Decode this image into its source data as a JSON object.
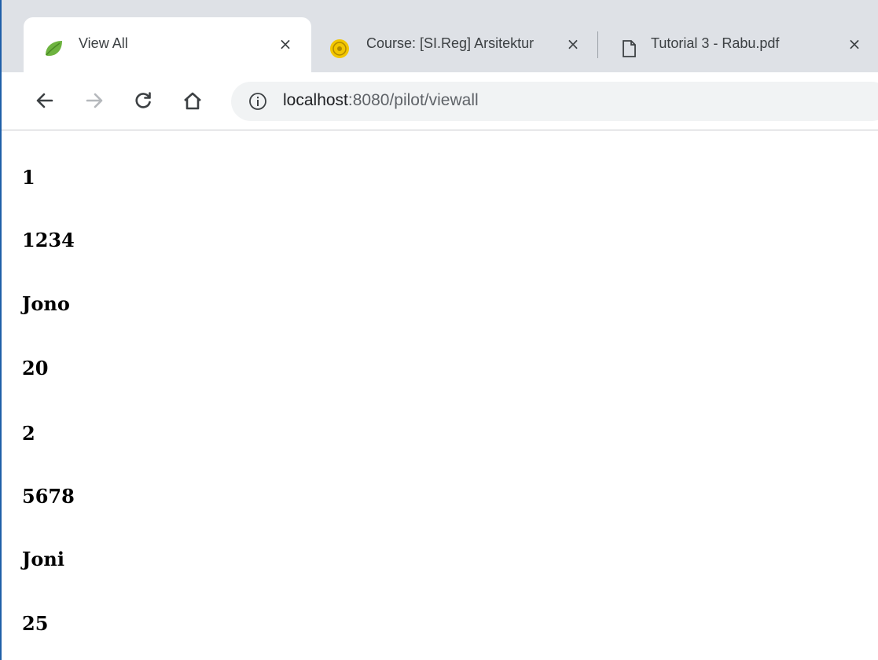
{
  "browser": {
    "tabs": [
      {
        "title": "View All",
        "favicon": "spring-leaf-icon",
        "active": true
      },
      {
        "title": "Course: [SI.Reg] Arsitektur",
        "favicon": "university-seal-icon",
        "active": false
      },
      {
        "title": "Tutorial 3 - Rabu.pdf",
        "favicon": "document-icon",
        "active": false
      }
    ],
    "close_glyph": "×",
    "url": {
      "host": "localhost",
      "rest": ":8080/pilot/viewall"
    }
  },
  "page": {
    "items": [
      "1",
      "1234",
      "Jono",
      "20",
      "2",
      "5678",
      "Joni",
      "25"
    ]
  },
  "colors": {
    "tab_strip": "#dee1e6",
    "omnibox": "#f1f3f4",
    "spring_green": "#6db33f"
  }
}
